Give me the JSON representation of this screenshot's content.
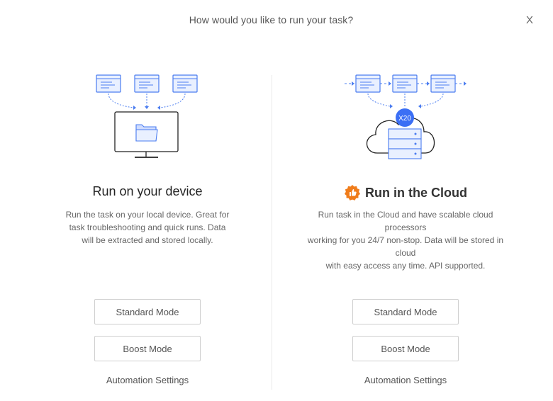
{
  "dialog": {
    "title": "How would you like to run your task?",
    "close_label": "X"
  },
  "local": {
    "title": "Run on your device",
    "desc_lines": [
      "Run the task on your local device. Great for",
      "task troubleshooting and quick runs. Data",
      "will be extracted and stored locally."
    ],
    "standard_label": "Standard Mode",
    "boost_label": "Boost Mode",
    "automation_label": "Automation Settings"
  },
  "cloud": {
    "title": "Run in the Cloud",
    "badge_icon": "thumbs-up-icon",
    "badge_color": "#f07c1a",
    "multiplier": "X20",
    "desc_lines": [
      "Run task in the Cloud and have scalable cloud processors",
      "working for you 24/7 non-stop. Data will be stored in cloud",
      "with easy access any time. API supported."
    ],
    "standard_label": "Standard Mode",
    "boost_label": "Boost Mode",
    "automation_label": "Automation Settings"
  },
  "colors": {
    "accent": "#3b6ff5",
    "doc_fill": "#e9f0ff",
    "doc_stroke": "#4a7cf0"
  }
}
